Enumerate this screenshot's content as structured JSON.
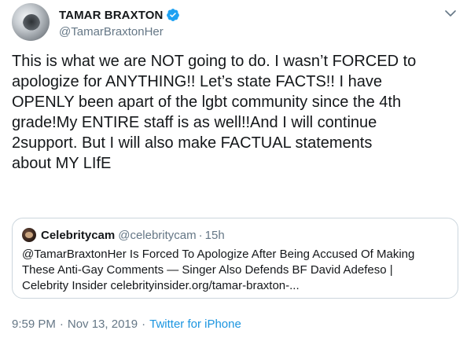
{
  "author": {
    "display_name": "TAMAR BRAXTON",
    "handle": "@TamarBraxtonHer",
    "verified": true,
    "avatar_icon": "profile-photo"
  },
  "tweet": {
    "text": "This is what we are NOT going to do. I wasn’t FORCED to\napologize for ANYTHING!! Let’s state FACTS!! I have\nOPENLY been apart of the lgbt community since the 4th\ngrade!My ENTIRE staff is as well!!And I will continue\n2support. But I will also make FACTUAL statements\nabout MY LIfE"
  },
  "quote": {
    "display_name": "Celebritycam",
    "handle": "@celebritycam",
    "separator": "·",
    "time": "15h",
    "text": "@TamarBraxtonHer Is Forced To Apologize After Being Accused Of Making\nThese Anti-Gay Comments — Singer Also Defends BF David Adefeso |\nCelebrity Insider celebrityinsider.org/tamar-braxton-..."
  },
  "meta": {
    "time": "9:59 PM",
    "separator": "·",
    "date": "Nov 13, 2019",
    "separator2": "·",
    "source": "Twitter for iPhone"
  },
  "colors": {
    "accent": "#1b95e0",
    "verified": "#1da1f2",
    "secondary_text": "#657786",
    "border": "#ccd6dd"
  }
}
